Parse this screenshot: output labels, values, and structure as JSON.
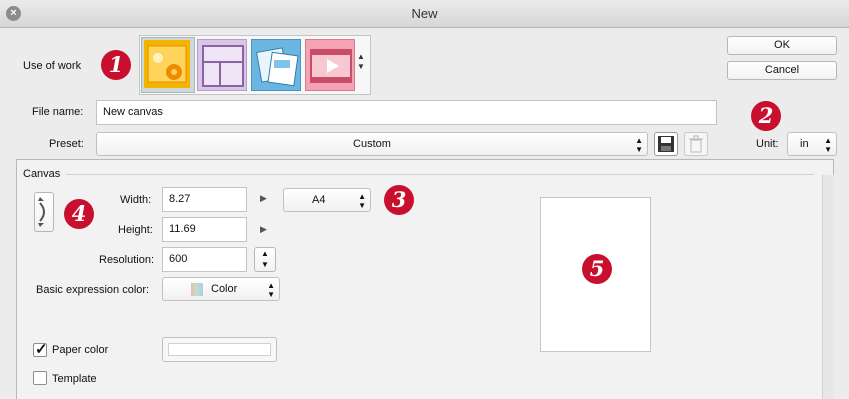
{
  "window": {
    "title": "New"
  },
  "use_of_work": {
    "label": "Use of work",
    "options": [
      {
        "name": "illustration-icon",
        "selected": true
      },
      {
        "name": "comic-icon",
        "selected": false
      },
      {
        "name": "webtoon-icon",
        "selected": false
      },
      {
        "name": "animation-icon",
        "selected": false
      }
    ]
  },
  "buttons": {
    "ok": "OK",
    "cancel": "Cancel"
  },
  "file_name": {
    "label": "File name:",
    "value": "New canvas"
  },
  "preset": {
    "label": "Preset:",
    "value": "Custom"
  },
  "unit": {
    "label": "Unit:",
    "value": "in"
  },
  "canvas": {
    "section_label": "Canvas",
    "width": {
      "label": "Width:",
      "value": "8.27"
    },
    "height": {
      "label": "Height:",
      "value": "11.69"
    },
    "paper_size": "A4",
    "resolution": {
      "label": "Resolution:",
      "value": "600"
    },
    "basic_color": {
      "label": "Basic expression color:",
      "value": "Color"
    },
    "paper_color": {
      "label": "Paper color",
      "checked": true
    },
    "template": {
      "label": "Template",
      "checked": false
    }
  },
  "callouts": [
    "1",
    "2",
    "3",
    "4",
    "5"
  ],
  "colors": {
    "badge": "#c8102e",
    "selected_tab": "#f5b400"
  }
}
